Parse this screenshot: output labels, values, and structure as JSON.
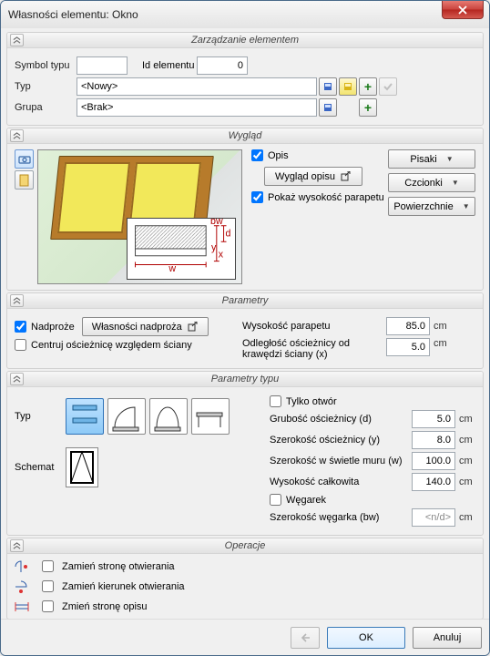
{
  "title": "Własności elementu: Okno",
  "sections": {
    "manage": "Zarządzanie elementem",
    "view": "Wygląd",
    "params": "Parametry",
    "params_type": "Parametry typu",
    "ops": "Operacje"
  },
  "manage": {
    "symbol_lbl": "Symbol typu",
    "symbol": "",
    "id_lbl": "Id elementu",
    "id": "0",
    "typ_lbl": "Typ",
    "typ_val": "<Nowy>",
    "grupa_lbl": "Grupa",
    "grupa_val": "<Brak>"
  },
  "view": {
    "opis_lbl": "Opis",
    "opis_checked": true,
    "wyglad_opisu_btn": "Wygląd opisu",
    "pokaz_lbl": "Pokaż wysokość parapetu",
    "pokaz_checked": true,
    "pisaki": "Pisaki",
    "czcionki": "Czcionki",
    "powierzchnie": "Powierzchnie"
  },
  "params": {
    "nadproze_lbl": "Nadproże",
    "nadproze_checked": true,
    "nadproze_btn": "Własności nadproża",
    "centruj_lbl": "Centruj ościeżnicę względem ściany",
    "centruj_checked": false,
    "wys_par_lbl": "Wysokość parapetu",
    "wys_par_val": "85.0",
    "odl_lbl_1": "Odległość ościeżnicy od",
    "odl_lbl_2": "krawędzi ściany (x)",
    "odl_val": "5.0",
    "unit": "cm"
  },
  "ptype": {
    "typ_lbl": "Typ",
    "schemat_lbl": "Schemat",
    "tylko_otwor_lbl": "Tylko otwór",
    "tylko_otwor_checked": false,
    "grubosc_lbl": "Grubość ościeżnicy (d)",
    "grubosc_val": "5.0",
    "szer_y_lbl": "Szerokość ościeżnicy (y)",
    "szer_y_val": "8.0",
    "szer_w_lbl": "Szerokość w świetle muru (w)",
    "szer_w_val": "100.0",
    "wys_lbl": "Wysokość całkowita",
    "wys_val": "140.0",
    "wegarek_lbl": "Węgarek",
    "wegarek_checked": false,
    "szer_bw_lbl": "Szerokość węgarka (bw)",
    "szer_bw_val": "<n/d>",
    "unit": "cm"
  },
  "ops": {
    "a": "Zamień stronę otwierania",
    "b": "Zamień kierunek otwierania",
    "c": "Zmień stronę opisu"
  },
  "footer": {
    "ok": "OK",
    "cancel": "Anuluj"
  }
}
